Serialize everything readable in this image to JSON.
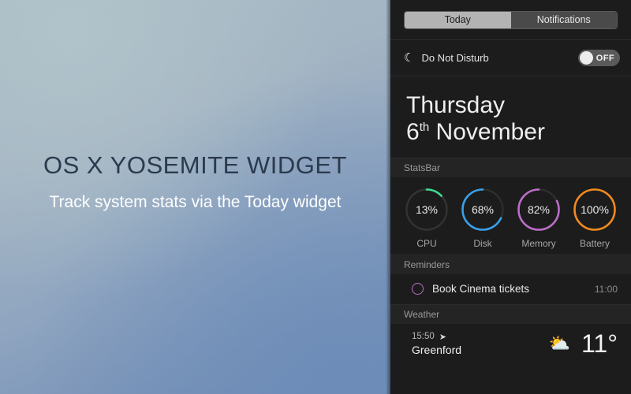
{
  "promo": {
    "title": "OS X YOSEMITE WIDGET",
    "subtitle": "Track system stats via the Today widget"
  },
  "notification_center": {
    "tabs": [
      {
        "label": "Today",
        "selected": true
      },
      {
        "label": "Notifications",
        "selected": false
      }
    ],
    "do_not_disturb": {
      "icon": "moon-icon",
      "label": "Do Not Disturb",
      "toggle_state": "OFF"
    },
    "date": {
      "weekday": "Thursday",
      "day": "6",
      "ordinal": "th",
      "month": "November"
    },
    "sections": {
      "stats": {
        "header": "StatsBar",
        "items": [
          {
            "label": "CPU",
            "value": "13%",
            "percent": 13,
            "color": "#3ddc97",
            "direction": "clockwise"
          },
          {
            "label": "Disk",
            "value": "68%",
            "percent": 68,
            "color": "#3aa0e8",
            "direction": "counter-clockwise"
          },
          {
            "label": "Memory",
            "value": "82%",
            "percent": 82,
            "color": "#bb6ec7",
            "direction": "counter-clockwise"
          },
          {
            "label": "Battery",
            "value": "100%",
            "percent": 100,
            "color": "#f08a1e",
            "direction": "clockwise"
          }
        ],
        "track_color": "#333333"
      },
      "reminders": {
        "header": "Reminders",
        "items": [
          {
            "title": "Book Cinema tickets",
            "time": "11:00",
            "bullet_color": "#bb6ec7"
          }
        ]
      },
      "weather": {
        "header": "Weather",
        "time": "15:50",
        "location_icon": "location-arrow-icon",
        "city": "Greenford",
        "condition_icon": "sun-behind-cloud-icon",
        "temperature": "11°"
      }
    }
  }
}
